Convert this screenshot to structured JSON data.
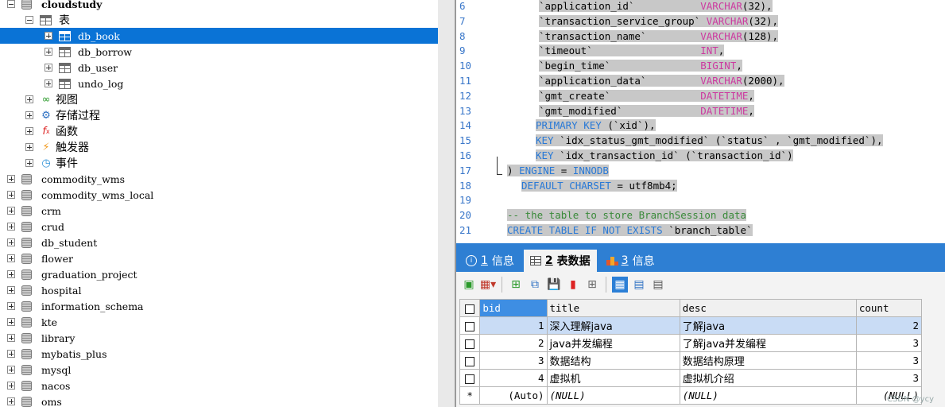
{
  "tree": {
    "root_db": "cloudstudy",
    "tables_folder": "表",
    "tables": [
      "db_book",
      "db_borrow",
      "db_user",
      "undo_log"
    ],
    "selected_table": "db_book",
    "folders": [
      {
        "label": "视图",
        "icon": "view-icon"
      },
      {
        "label": "存储过程",
        "icon": "gear-icon"
      },
      {
        "label": "函数",
        "icon": "function-icon"
      },
      {
        "label": "触发器",
        "icon": "lightning-icon"
      },
      {
        "label": "事件",
        "icon": "clock-icon"
      }
    ],
    "databases": [
      "commodity_wms",
      "commodity_wms_local",
      "crm",
      "crud",
      "db_student",
      "flower",
      "graduation_project",
      "hospital",
      "information_schema",
      "kte",
      "library",
      "mybatis_plus",
      "mysql",
      "nacos",
      "oms"
    ]
  },
  "editor": {
    "lines": [
      {
        "n": "6",
        "parts": [
          [
            "str",
            "`application_id`           "
          ],
          [
            "ty",
            "VARCHAR"
          ],
          [
            "plain",
            "(32),"
          ]
        ]
      },
      {
        "n": "7",
        "parts": [
          [
            "str",
            "`transaction_service_group` "
          ],
          [
            "ty",
            "VARCHAR"
          ],
          [
            "plain",
            "(32),"
          ]
        ]
      },
      {
        "n": "8",
        "parts": [
          [
            "str",
            "`transaction_name`         "
          ],
          [
            "ty",
            "VARCHAR"
          ],
          [
            "plain",
            "(128),"
          ]
        ]
      },
      {
        "n": "9",
        "parts": [
          [
            "str",
            "`timeout`                  "
          ],
          [
            "ty",
            "INT"
          ],
          [
            "plain",
            ","
          ]
        ]
      },
      {
        "n": "10",
        "parts": [
          [
            "str",
            "`begin_time`               "
          ],
          [
            "ty",
            "BIGINT"
          ],
          [
            "plain",
            ","
          ]
        ]
      },
      {
        "n": "11",
        "parts": [
          [
            "str",
            "`application_data`         "
          ],
          [
            "ty",
            "VARCHAR"
          ],
          [
            "plain",
            "(2000),"
          ]
        ]
      },
      {
        "n": "12",
        "parts": [
          [
            "str",
            "`gmt_create`               "
          ],
          [
            "ty",
            "DATETIME"
          ],
          [
            "plain",
            ","
          ]
        ]
      },
      {
        "n": "13",
        "parts": [
          [
            "str",
            "`gmt_modified`             "
          ],
          [
            "ty",
            "DATETIME"
          ],
          [
            "plain",
            ","
          ]
        ]
      },
      {
        "n": "14",
        "parts": [
          [
            "kw",
            "PRIMARY KEY "
          ],
          [
            "plain",
            "(`xid`),"
          ]
        ]
      },
      {
        "n": "15",
        "parts": [
          [
            "kw",
            "KEY "
          ],
          [
            "plain",
            "`idx_status_gmt_modified` (`status` , `gmt_modified`),"
          ]
        ]
      },
      {
        "n": "16",
        "parts": [
          [
            "kw",
            "KEY "
          ],
          [
            "plain",
            "`idx_transaction_id` (`transaction_id`)"
          ]
        ]
      },
      {
        "n": "17",
        "parts": [
          [
            "plain",
            ") "
          ],
          [
            "kw",
            "ENGINE"
          ],
          [
            "plain",
            " = "
          ],
          [
            "kw",
            "INNODB"
          ]
        ]
      },
      {
        "n": "18",
        "parts": [
          [
            "kw",
            "DEFAULT CHARSET"
          ],
          [
            "plain",
            " = utf8mb4;"
          ]
        ]
      },
      {
        "n": "19",
        "parts": []
      },
      {
        "n": "20",
        "parts": [
          [
            "comment",
            "-- the table to store BranchSession data"
          ]
        ]
      },
      {
        "n": "21",
        "parts": [
          [
            "kw",
            "CREATE TABLE IF NOT EXISTS "
          ],
          [
            "plain",
            "`branch_table`"
          ]
        ]
      }
    ]
  },
  "tabs": [
    {
      "num": "1",
      "label": "信息"
    },
    {
      "num": "2",
      "label": "表数据"
    },
    {
      "num": "3",
      "label": "信息"
    }
  ],
  "grid": {
    "columns": [
      "bid",
      "title",
      "desc",
      "count"
    ],
    "rows": [
      {
        "bid": "1",
        "title": "深入理解java",
        "desc": "了解java",
        "count": "2"
      },
      {
        "bid": "2",
        "title": "java并发编程",
        "desc": "了解java并发编程",
        "count": "3"
      },
      {
        "bid": "3",
        "title": "数据结构",
        "desc": "数据结构原理",
        "count": "3"
      },
      {
        "bid": "4",
        "title": "虚拟机",
        "desc": "虚拟机介绍",
        "count": "3"
      }
    ],
    "new_row": {
      "marker": "*",
      "bid": "(Auto)",
      "title": "(NULL)",
      "desc": "(NULL)",
      "count": "(NULL)"
    }
  },
  "watermark": "CSDN @ycy",
  "colors": {
    "accent": "#0a73d6",
    "tab_bar": "#2e7fd3",
    "keyword": "#2979d6",
    "type": "#cc3aa0"
  }
}
